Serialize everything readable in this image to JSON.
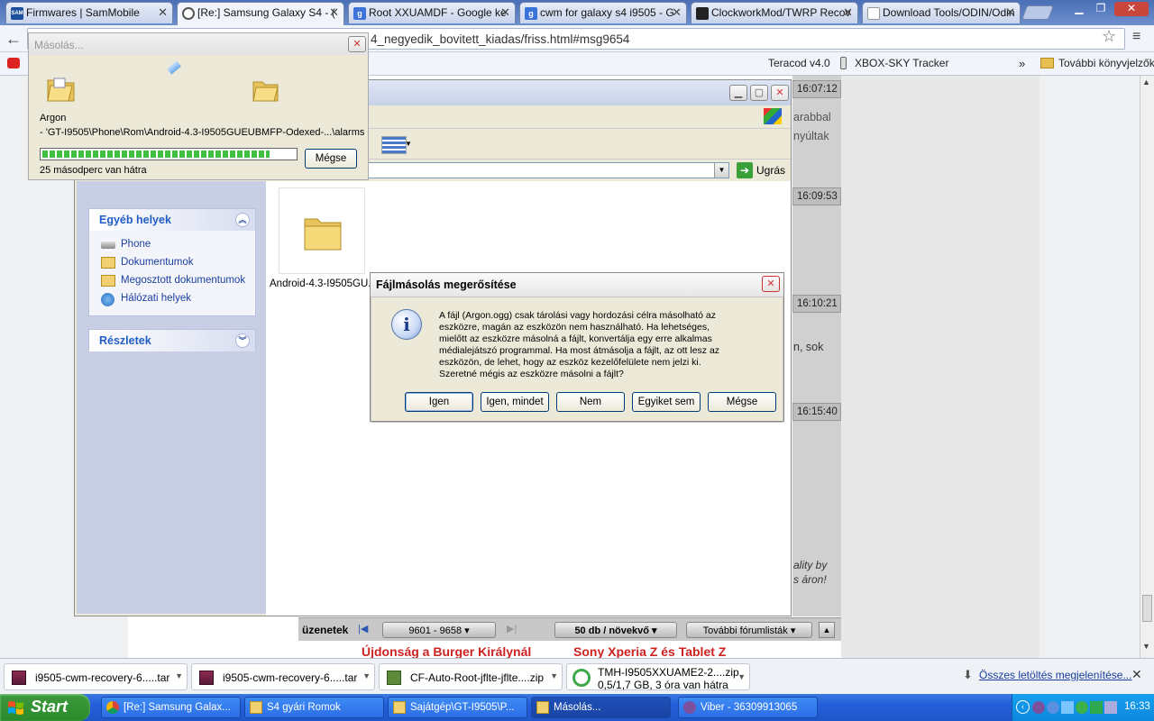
{
  "browser": {
    "tabs": [
      {
        "label": "Firmwares | SamMobile",
        "icon_text": "SAM",
        "icon_color": "#1d4f9c"
      },
      {
        "label": "[Re:] Samsung Galaxy S4 - (",
        "icon_text": "",
        "icon_color": "#666666"
      },
      {
        "label": "Root XXUAMDF - Google ke",
        "icon_text": "g",
        "icon_color": "#3b73d9"
      },
      {
        "label": "cwm for galaxy s4 i9505 - G",
        "icon_text": "g",
        "icon_color": "#3b73d9"
      },
      {
        "label": "ClockworkMod/TWRP Recov",
        "icon_text": "",
        "icon_color": "#222222"
      },
      {
        "label": "Download Tools/ODIN/Odin",
        "icon_text": "",
        "icon_color": "#d9a441"
      }
    ],
    "url": "4_negyedik_bovitett_kiadas/friss.html#msg9654",
    "bookmarks": {
      "teracod": "Teracod v4.0",
      "xbox": "XBOX-SKY Tracker",
      "chevron": "»",
      "more": "További könyvjelzők"
    }
  },
  "forum": {
    "timestamps": [
      "16:07:12",
      "16:09:53",
      "16:10:21",
      "16:15:40"
    ],
    "snippets": [
      "arabbal",
      "nyúltak",
      "n, sok",
      "ality by",
      "s áron!"
    ],
    "pager": {
      "label": "üzenetek",
      "range": "9601 - 9658",
      "per_page": "50 db / növekvő",
      "more_lists": "További fórumlisták"
    },
    "bottom_links": [
      "Újdonság a Burger Királynál",
      "Sony Xperia Z és Tablet Z"
    ]
  },
  "explorer": {
    "go_label": "Ugrás",
    "other_places": {
      "title": "Egyéb helyek",
      "items": [
        "Phone",
        "Dokumentumok",
        "Megosztott dokumentumok",
        "Hálózati helyek"
      ]
    },
    "details_title": "Részletek",
    "folder_name": "Android-4.3-I9505GU..."
  },
  "copy_progress": {
    "title": "Másolás...",
    "file": "Argon",
    "path": "- 'GT-I9505\\Phone\\Rom\\Android-4.3-I9505GUEUBMFP-Odexed-...\\alarms'",
    "progress": 0.9,
    "remaining": "25 másodperc van hátra",
    "cancel_label": "Mégse"
  },
  "dialog": {
    "title": "Fájlmásolás megerősítése",
    "lines": [
      "A fájl (Argon.ogg) csak tárolási vagy hordozási célra másolható az",
      "eszközre, magán az eszközön nem használható. Ha lehetséges,",
      "mielőtt az eszközre másolná a fájlt, konvertálja egy erre alkalmas",
      "médialejátszó programmal. Ha most átmásolja a fájlt, az ott lesz az",
      "eszközön, de lehet, hogy az eszköz kezelőfelülete nem jelzi ki.",
      "Szeretné mégis az eszközre másolni a fájlt?"
    ],
    "buttons": [
      "Igen",
      "Igen, mindet",
      "Nem",
      "Egyiket sem",
      "Mégse"
    ]
  },
  "downloads": {
    "items": [
      {
        "name": "i9505-cwm-recovery-6.....tar",
        "status": ""
      },
      {
        "name": "i9505-cwm-recovery-6.....tar",
        "status": ""
      },
      {
        "name": "CF-Auto-Root-jflte-jflte....zip",
        "status": ""
      },
      {
        "name": "TMH-I9505XXUAME2-2....zip",
        "status": "0,5/1,7 GB, 3 óra van hátra"
      }
    ],
    "show_all": "Összes letöltés megjelenítése..."
  },
  "taskbar": {
    "start": "Start",
    "tasks": [
      "[Re:] Samsung Galax...",
      "S4 gyári Romok",
      "Sajátgép\\GT-I9505\\P...",
      "Másolás...",
      "Viber - 36309913065"
    ],
    "clock": "16:33"
  }
}
